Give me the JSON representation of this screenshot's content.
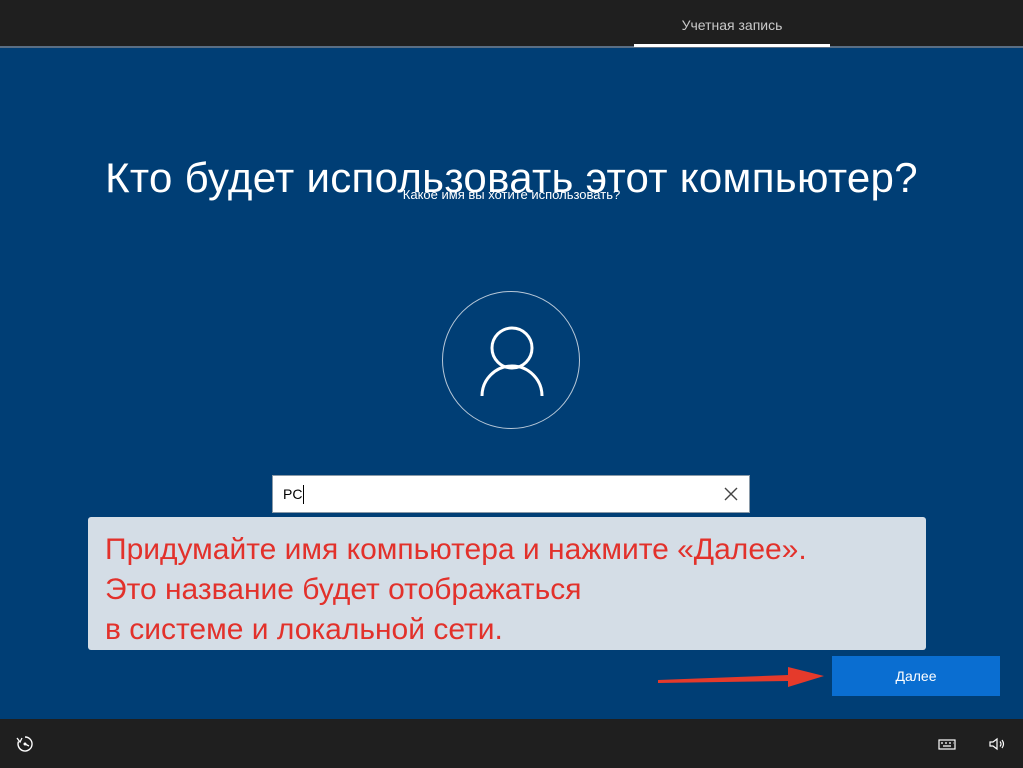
{
  "header": {
    "tab_account": "Учетная запись"
  },
  "main": {
    "title": "Кто будет использовать этот компьютер?",
    "subtitle": "Какое имя вы хотите использовать?",
    "name_value": "PC"
  },
  "callout": {
    "lines": [
      "Придумайте имя компьютера и нажмите «Далее».",
      "Это название будет отображаться",
      "в системе и локальной сети."
    ]
  },
  "actions": {
    "next_label": "Далее"
  },
  "icons": {
    "avatar": "user-avatar-icon",
    "clear": "close-icon",
    "accessibility": "ease-of-access-icon",
    "keyboard": "keyboard-icon",
    "volume": "volume-icon"
  },
  "colors": {
    "background": "#003e75",
    "bar": "#1f1f1f",
    "button": "#0a6ed1",
    "callout_bg": "#d4dde6",
    "callout_text": "#e2312b",
    "arrow": "#e53a2b"
  }
}
